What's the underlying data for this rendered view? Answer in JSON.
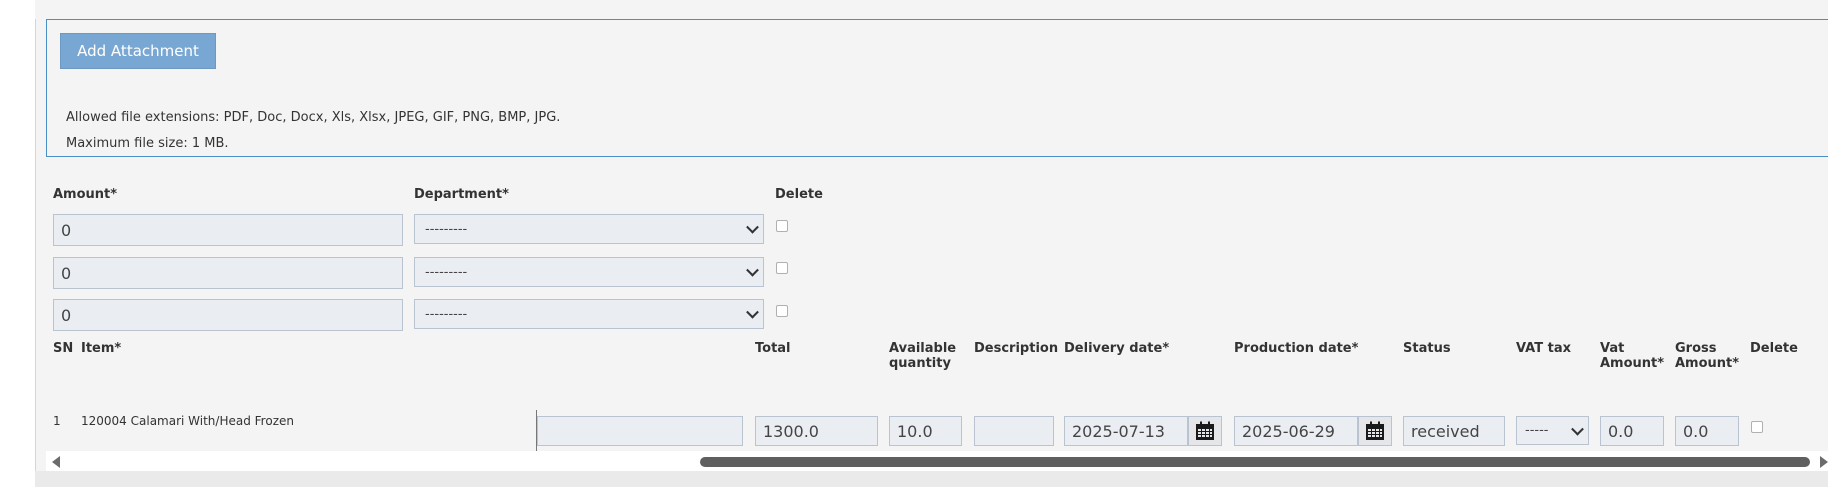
{
  "attachments": {
    "add_button": "Add Attachment",
    "allowed_extensions": "Allowed file extensions: PDF, Doc, Docx, Xls, Xlsx, JPEG, GIF, PNG, BMP, JPG.",
    "max_size": "Maximum file size: 1 MB."
  },
  "cost_split": {
    "headers": {
      "amount": "Amount*",
      "department": "Department*",
      "delete": "Delete"
    },
    "rows": [
      {
        "amount": "0",
        "department": "---------"
      },
      {
        "amount": "0",
        "department": "---------"
      },
      {
        "amount": "0",
        "department": "---------"
      }
    ]
  },
  "items_table": {
    "headers": {
      "sn": "SN",
      "item": "Item*",
      "total": "Total",
      "available_quantity_line1": "Available",
      "available_quantity_line2": "quantity",
      "description": "Description",
      "delivery_date": "Delivery date*",
      "production_date": "Production date*",
      "status": "Status",
      "vat_tax": "VAT tax",
      "vat_amount_line1": "Vat",
      "vat_amount_line2": "Amount*",
      "gross_amount_line1": "Gross",
      "gross_amount_line2": "Amount*",
      "delete": "Delete"
    },
    "rows": [
      {
        "sn": "1",
        "item": "120004 Calamari With/Head Frozen",
        "extra": "",
        "total": "1300.0",
        "available_quantity": "10.0",
        "description": "",
        "delivery_date": "2025-07-13",
        "production_date": "2025-06-29",
        "status": "received",
        "vat_tax": "-----",
        "vat_amount": "0.0",
        "gross_amount": "0.0"
      }
    ]
  },
  "icons": {
    "calendar": "calendar-icon",
    "chevron": "chevron-down-icon"
  },
  "colors": {
    "accent_button": "#79a7d3",
    "box_border": "#4b8fc7",
    "input_bg": "#eaeef3"
  }
}
